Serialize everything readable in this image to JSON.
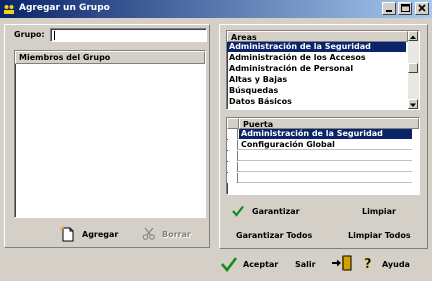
{
  "window": {
    "title": "Agregar un Grupo",
    "minimize_icon": "minimize-icon",
    "maximize_icon": "maximize-icon",
    "close_icon": "close-icon"
  },
  "left_panel": {
    "group_label": "Grupo:",
    "group_value": "",
    "members_header": "Miembros del Grupo",
    "members": [],
    "add_button": "Agregar",
    "delete_button": "Borrar"
  },
  "areas": {
    "header": "Areas",
    "items": [
      "Administración de la Seguridad",
      "Administración de los Accesos",
      "Administración de Personal",
      "Altas y Bajas",
      "Búsquedas",
      "Datos Básicos"
    ],
    "selected_index": 0
  },
  "puerta": {
    "header": "Puerta",
    "items": [
      "Administración de la Seguridad",
      "Configuración Global"
    ],
    "selected_index": 0
  },
  "right_buttons": {
    "grant": "Garantizar",
    "clear": "Limpiar",
    "grant_all": "Garantizar Todos",
    "clear_all": "Limpiar Todos"
  },
  "footer": {
    "accept": "Aceptar",
    "exit": "Salir",
    "help": "Ayuda"
  },
  "colors": {
    "title_start": "#0a246a",
    "title_end": "#a6caf0",
    "selection": "#0a246a",
    "check": "#1a8a1a",
    "face": "#d4d0c8"
  }
}
